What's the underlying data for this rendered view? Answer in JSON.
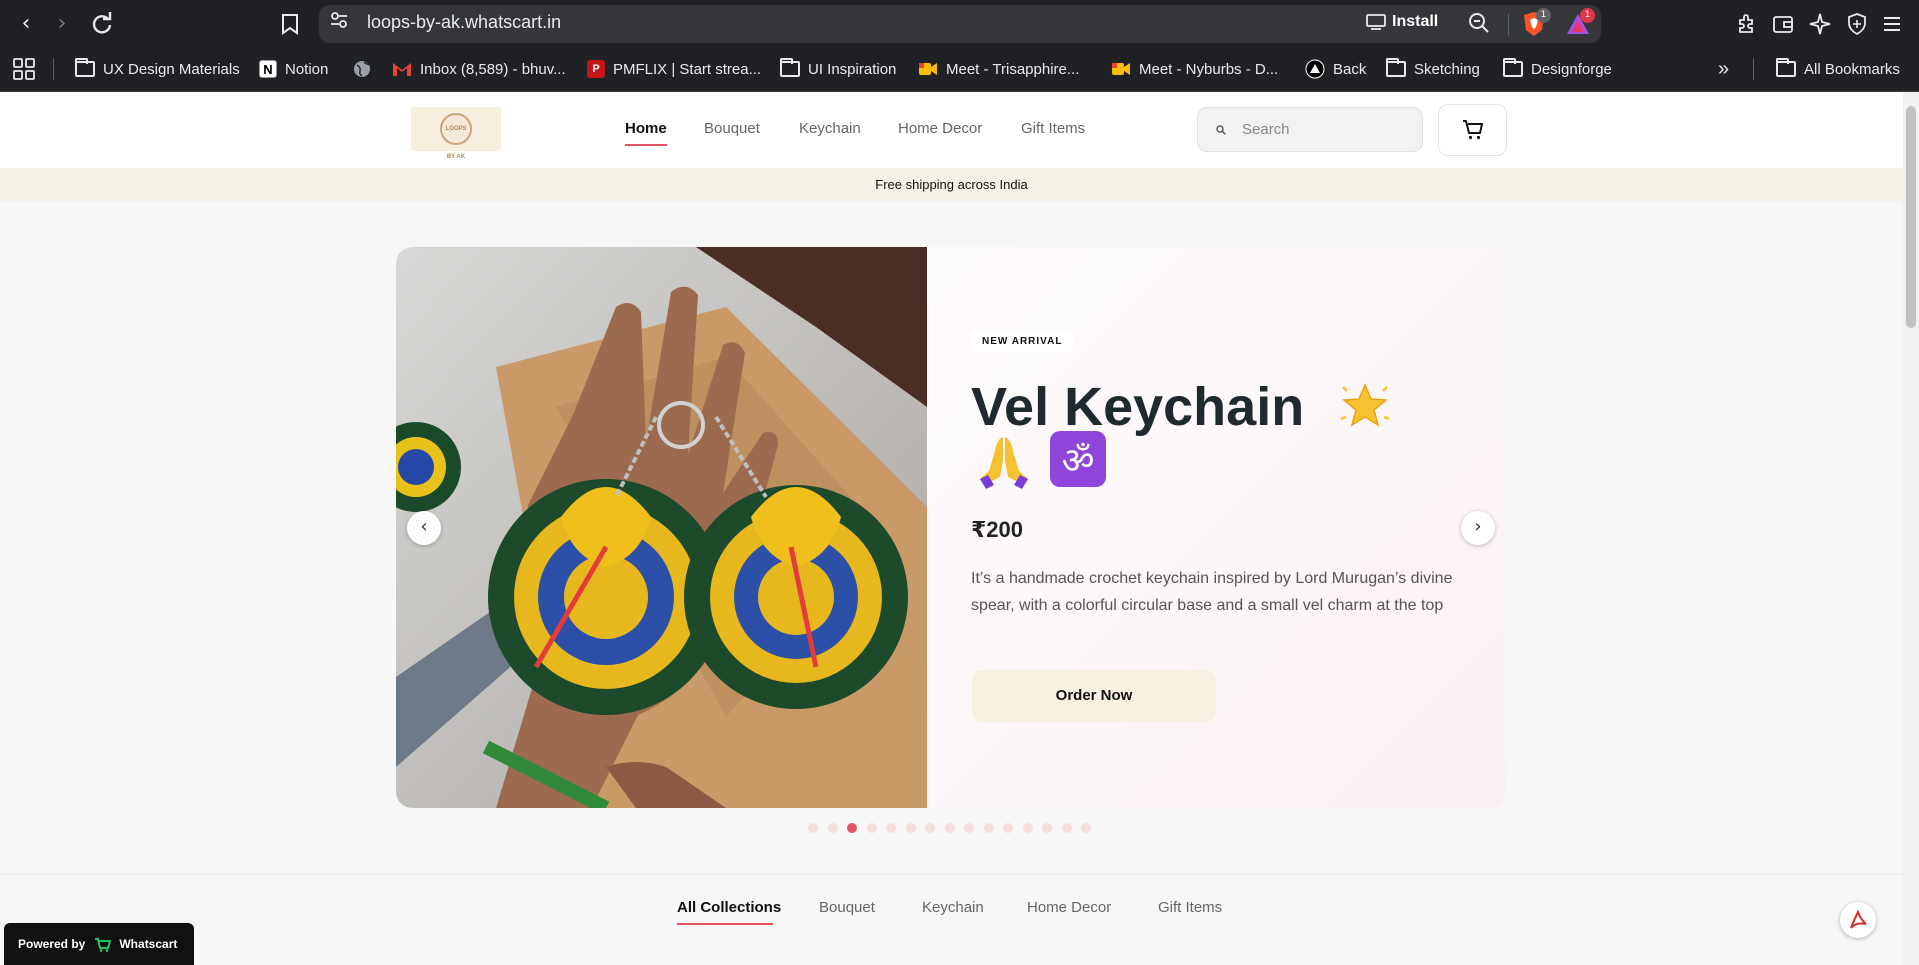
{
  "browser": {
    "url": "loops-by-ak.whatscart.in",
    "install_label": "Install",
    "brave_badge": "1",
    "rewards_badge": "1",
    "bookmarks": [
      {
        "label": "UX Design Materials",
        "icon": "folder-icon"
      },
      {
        "label": "Notion",
        "icon": "notion-icon"
      },
      {
        "label": "",
        "icon": "globe-icon"
      },
      {
        "label": "Inbox (8,589) - bhuv...",
        "icon": "gmail-icon"
      },
      {
        "label": "PMFLIX | Start strea...",
        "icon": "pmflix-icon"
      },
      {
        "label": "UI Inspiration",
        "icon": "folder-icon"
      },
      {
        "label": "Meet - Trisapphire...",
        "icon": "meet-icon"
      },
      {
        "label": "Meet - Nyburbs - D...",
        "icon": "meet-icon"
      },
      {
        "label": "Back",
        "icon": "back-app-icon"
      },
      {
        "label": "Sketching",
        "icon": "folder-icon"
      },
      {
        "label": "Designforge",
        "icon": "folder-icon"
      }
    ],
    "more_bookmarks": "»",
    "all_bookmarks": "All Bookmarks"
  },
  "header": {
    "logo_text": "LOOPS BY AK",
    "nav": [
      "Home",
      "Bouquet",
      "Keychain",
      "Home Decor",
      "Gift Items"
    ],
    "active_nav": "Home",
    "search_placeholder": "Search"
  },
  "announcement": "Free shipping across India",
  "hero": {
    "tag": "NEW ARRIVAL",
    "title": "Vel Keychain",
    "price": "₹200",
    "description": "It’s a handmade crochet keychain inspired by Lord Murugan’s divine spear, with a colorful circular base and a small vel charm at the top",
    "cta": "Order Now",
    "prev": "‹",
    "next": "›",
    "slide_count": 15,
    "active_slide": 3
  },
  "collections": {
    "tabs": [
      "All Collections",
      "Bouquet",
      "Keychain",
      "Home Decor",
      "Gift Items"
    ],
    "active": "All Collections"
  },
  "footer_badge": {
    "prefix": "Powered by",
    "brand": "Whatscart"
  },
  "colors": {
    "accent": "#e05561",
    "cream": "#f6f1e7",
    "dark": "#1f2a2e"
  }
}
